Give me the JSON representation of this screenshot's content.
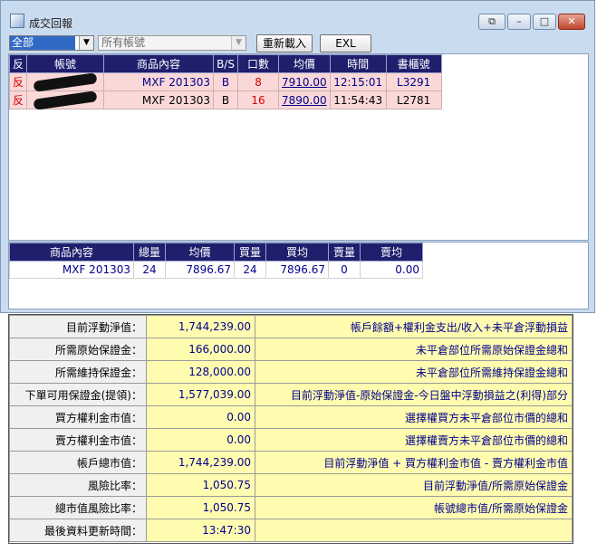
{
  "window": {
    "title": "成交回報",
    "controls": [
      "restore-icon",
      "minimize-icon",
      "maximize-icon",
      "close-icon"
    ]
  },
  "toolbar": {
    "filter_value": "全部",
    "account_placeholder": "所有帳號",
    "reload_label": "重新載入",
    "excel_label": "EXL"
  },
  "trades": {
    "headers": [
      "反",
      "帳號",
      "商品內容",
      "B/S",
      "口數",
      "均價",
      "時間",
      "書櫃號"
    ],
    "rows": [
      {
        "flag": "反",
        "account": "",
        "product": "MXF 201303",
        "bs": "B",
        "qty": "8",
        "price": "7910.00",
        "time": "12:15:01",
        "book": "L3291"
      },
      {
        "flag": "反",
        "account": "",
        "product": "MXF 201303",
        "bs": "B",
        "qty": "16",
        "price": "7890.00",
        "time": "11:54:43",
        "book": "L2781"
      }
    ]
  },
  "summary": {
    "headers": [
      "商品內容",
      "總量",
      "均價",
      "買量",
      "買均",
      "賣量",
      "賣均"
    ],
    "rows": [
      {
        "product": "MXF 201303",
        "total": "24",
        "avg": "7896.67",
        "buy_qty": "24",
        "buy_avg": "7896.67",
        "sell_qty": "0",
        "sell_avg": "0.00"
      }
    ]
  },
  "margin": {
    "rows": [
      {
        "label": "目前浮動淨值：",
        "value": "1,744,239.00",
        "desc": "帳戶餘額+權利金支出/收入+未平倉浮動損益"
      },
      {
        "label": "所需原始保證金：",
        "value": "166,000.00",
        "desc": "未平倉部位所需原始保證金總和"
      },
      {
        "label": "所需維持保證金：",
        "value": "128,000.00",
        "desc": "未平倉部位所需維持保證金總和"
      },
      {
        "label": "下單可用保證金(提領)：",
        "value": "1,577,039.00",
        "desc": "目前浮動淨值-原始保證金-今日盤中浮動損益之(利得)部分"
      },
      {
        "label": "買方權利金市值：",
        "value": "0.00",
        "desc": "選擇權買方未平倉部位市價的總和"
      },
      {
        "label": "賣方權利金市值：",
        "value": "0.00",
        "desc": "選擇權賣方未平倉部位市價的總和"
      },
      {
        "label": "帳戶總市值：",
        "value": "1,744,239.00",
        "desc": "目前浮動淨值 + 買方權利金市值 - 賣方權利金市值"
      },
      {
        "label": "風險比率：",
        "value": "1,050.75",
        "desc": "目前浮動淨值/所需原始保證金"
      },
      {
        "label": "總市值風險比率：",
        "value": "1,050.75",
        "desc": "帳號總市值/所需原始保證金"
      },
      {
        "label": "最後資料更新時間：",
        "value": "13:47:30",
        "desc": ""
      }
    ]
  }
}
